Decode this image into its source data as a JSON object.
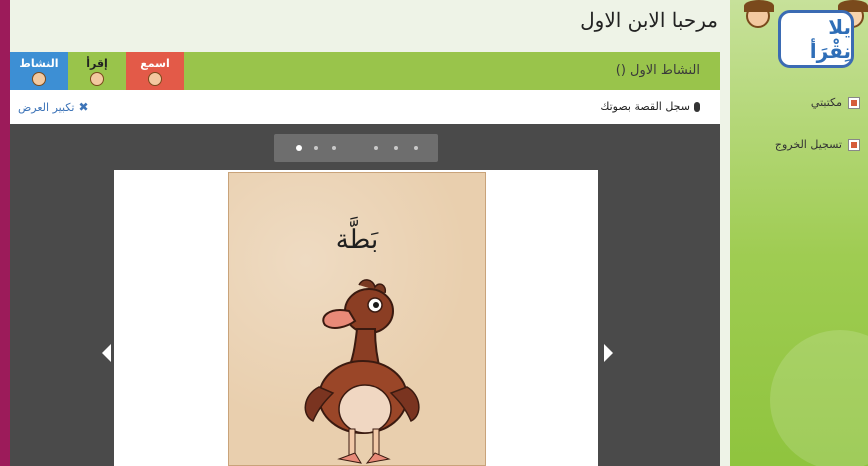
{
  "header": {
    "welcome": "مرحبا الابن الاول"
  },
  "logo": {
    "text": "يلا نِقْرَأ"
  },
  "sidebar": {
    "items": [
      {
        "label": "مكتبتي",
        "icon": "library-icon"
      },
      {
        "label": "تسجيل الخروج",
        "icon": "logout-icon"
      }
    ]
  },
  "activity": {
    "title": "النشاط الاول ()",
    "tabs": [
      {
        "label": "النشاط",
        "color": "#3d8fd4"
      },
      {
        "label": "إقرأ",
        "color": "#99c44b"
      },
      {
        "label": "اسمع",
        "color": "#e35a48"
      }
    ]
  },
  "toolbar": {
    "record_label": "سجل القصة بصوتك",
    "enlarge_label": "تكبير العرض"
  },
  "viewer": {
    "story_word": "بَطَّة",
    "slider_dots": 6
  },
  "colors": {
    "frame_border": "#9c1b5a",
    "accent_green": "#99c44b",
    "viewer_bg": "#4a4a4a"
  }
}
